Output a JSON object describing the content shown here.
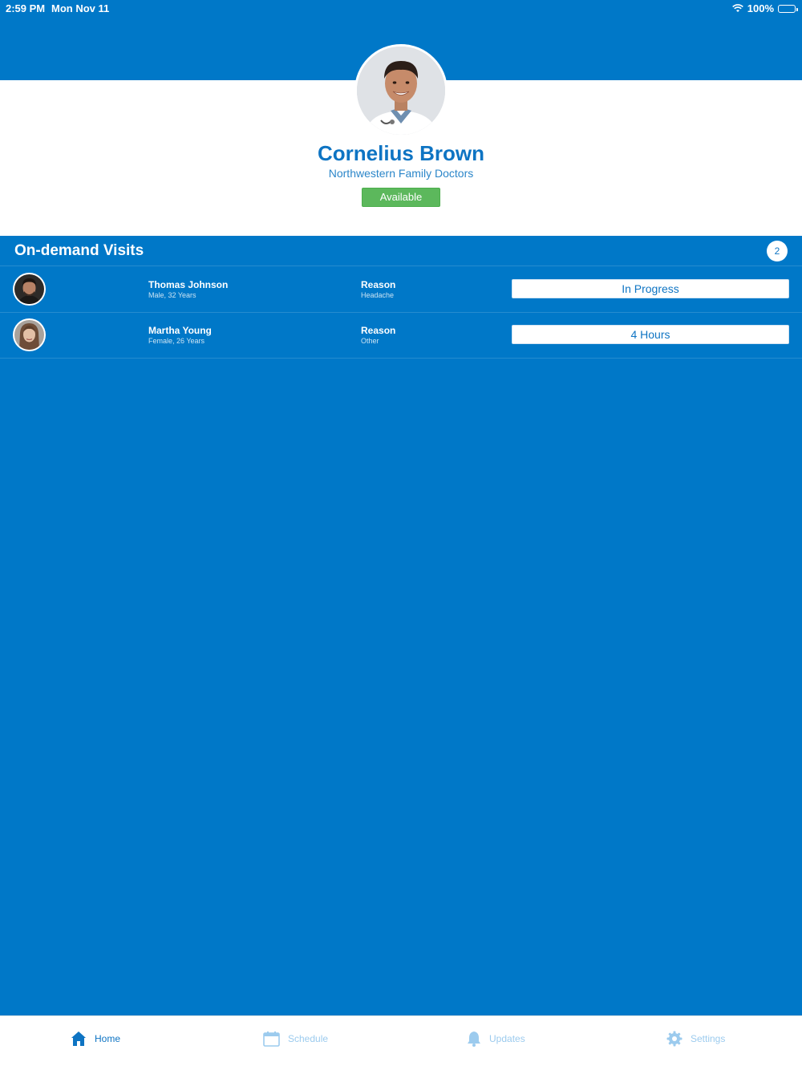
{
  "status_bar": {
    "time": "2:59 PM",
    "date": "Mon Nov 11",
    "battery": "100%"
  },
  "profile": {
    "name": "Cornelius Brown",
    "practice": "Northwestern Family Doctors",
    "status": "Available",
    "status_color": "#5cb85c"
  },
  "visits": {
    "title": "On-demand Visits",
    "count": "2",
    "items": [
      {
        "name": "Thomas Johnson",
        "info": "Male, 32 Years",
        "reason_label": "Reason",
        "reason": "Headache",
        "action": "In Progress"
      },
      {
        "name": "Martha Young",
        "info": "Female, 26 Years",
        "reason_label": "Reason",
        "reason": "Other",
        "action": "4 Hours"
      }
    ]
  },
  "tabs": [
    {
      "label": "Home",
      "icon": "home-icon",
      "active": true
    },
    {
      "label": "Schedule",
      "icon": "calendar-icon",
      "active": false
    },
    {
      "label": "Updates",
      "icon": "bell-icon",
      "active": false
    },
    {
      "label": "Settings",
      "icon": "gear-icon",
      "active": false
    }
  ],
  "colors": {
    "primary": "#0078c8",
    "accent_text": "#0e74c3",
    "inactive_tab": "#9ccbee"
  }
}
